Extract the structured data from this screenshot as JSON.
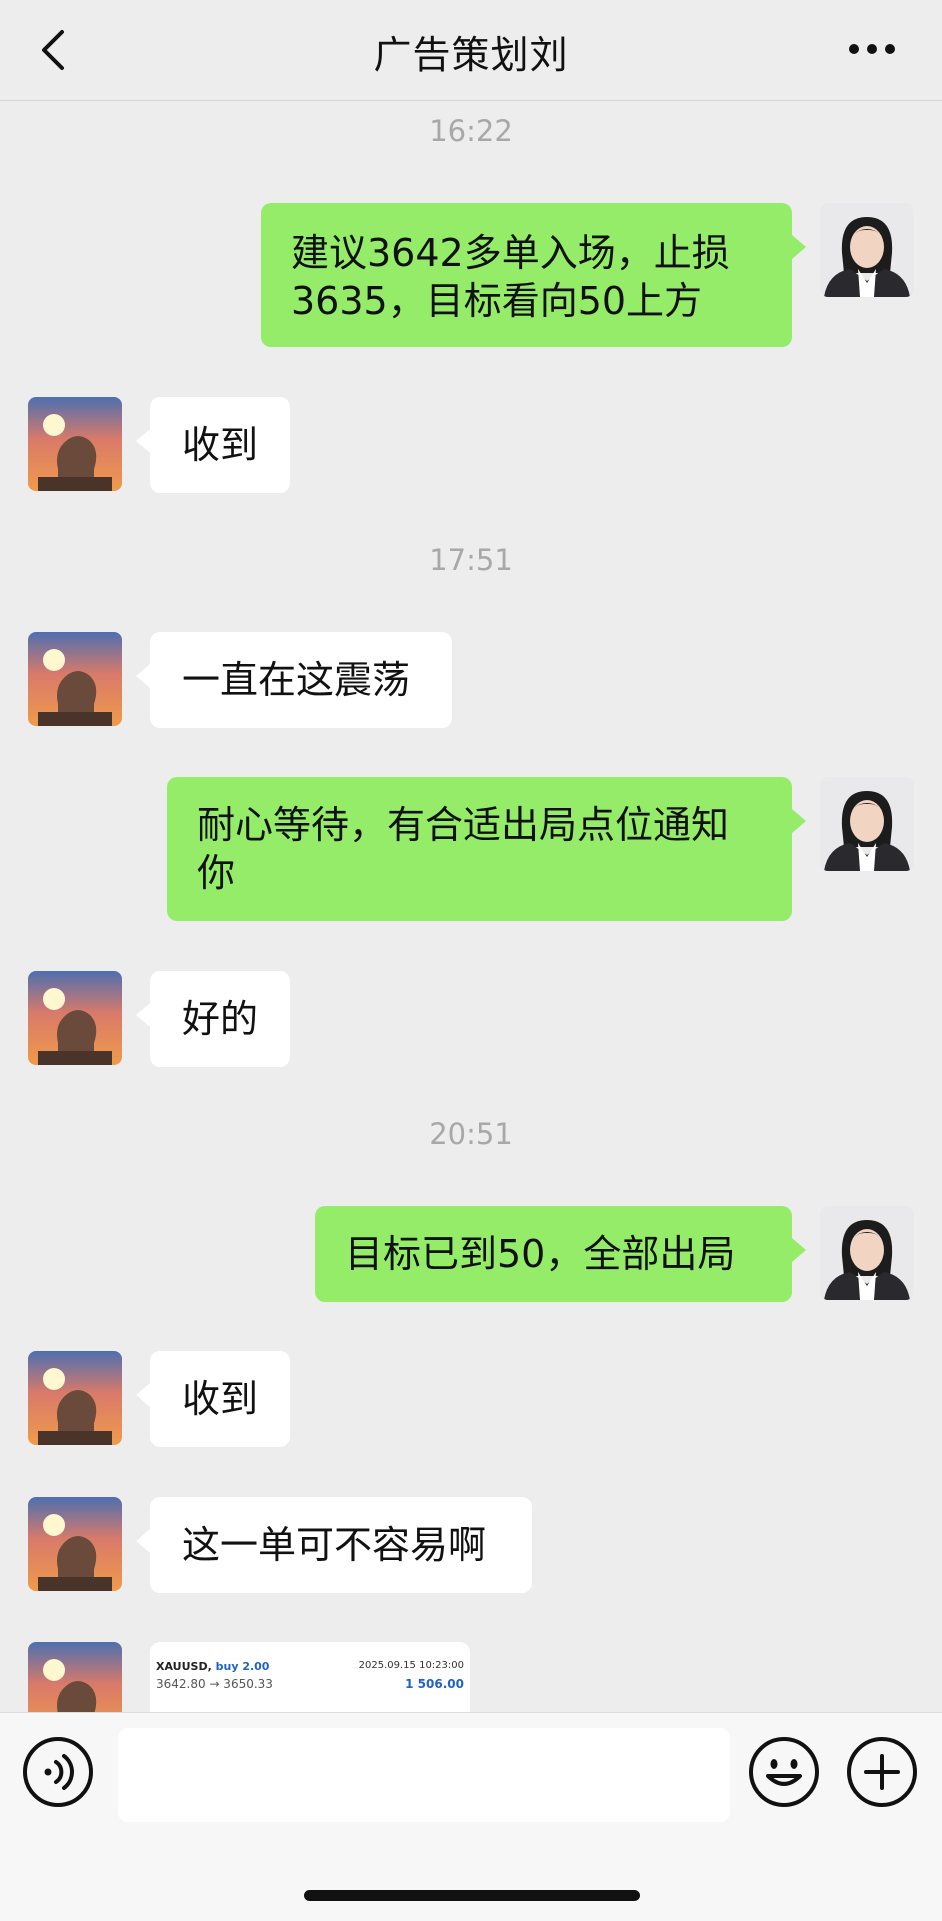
{
  "header": {
    "title": "广告策划刘",
    "back_icon": "chevron-left-icon",
    "more_icon": "more-dots-icon"
  },
  "messages": [
    {
      "time": "16:22"
    },
    {
      "side": "out",
      "text": "建议3642多单入场，止损3635，目标看向50上方"
    },
    {
      "side": "in",
      "text": "收到"
    },
    {
      "time": "17:51"
    },
    {
      "side": "in",
      "text": "一直在这震荡"
    },
    {
      "side": "out",
      "text": "耐心等待，有合适出局点位通知你"
    },
    {
      "side": "in",
      "text": "好的"
    },
    {
      "time": "20:51"
    },
    {
      "side": "out",
      "text": "目标已到50，全部出局"
    },
    {
      "side": "in",
      "text": "收到"
    },
    {
      "side": "in",
      "text": "这一单可不容易啊"
    }
  ],
  "trade_card": {
    "symbol": "XAUUSD,",
    "action": "buy 2.00",
    "datetime": "2025.09.15 10:23:00",
    "prices": "3642.80 → 3650.33",
    "profit": "1 506.00"
  },
  "input_bar": {
    "voice_icon": "voice-icon",
    "input_value": "",
    "emoji_icon": "smiley-icon",
    "plus_icon": "plus-circle-icon"
  },
  "colors": {
    "outgoing_bubble": "#95ec69",
    "incoming_bubble": "#ffffff",
    "background": "#ededed",
    "accent_blue": "#1e63c6"
  }
}
